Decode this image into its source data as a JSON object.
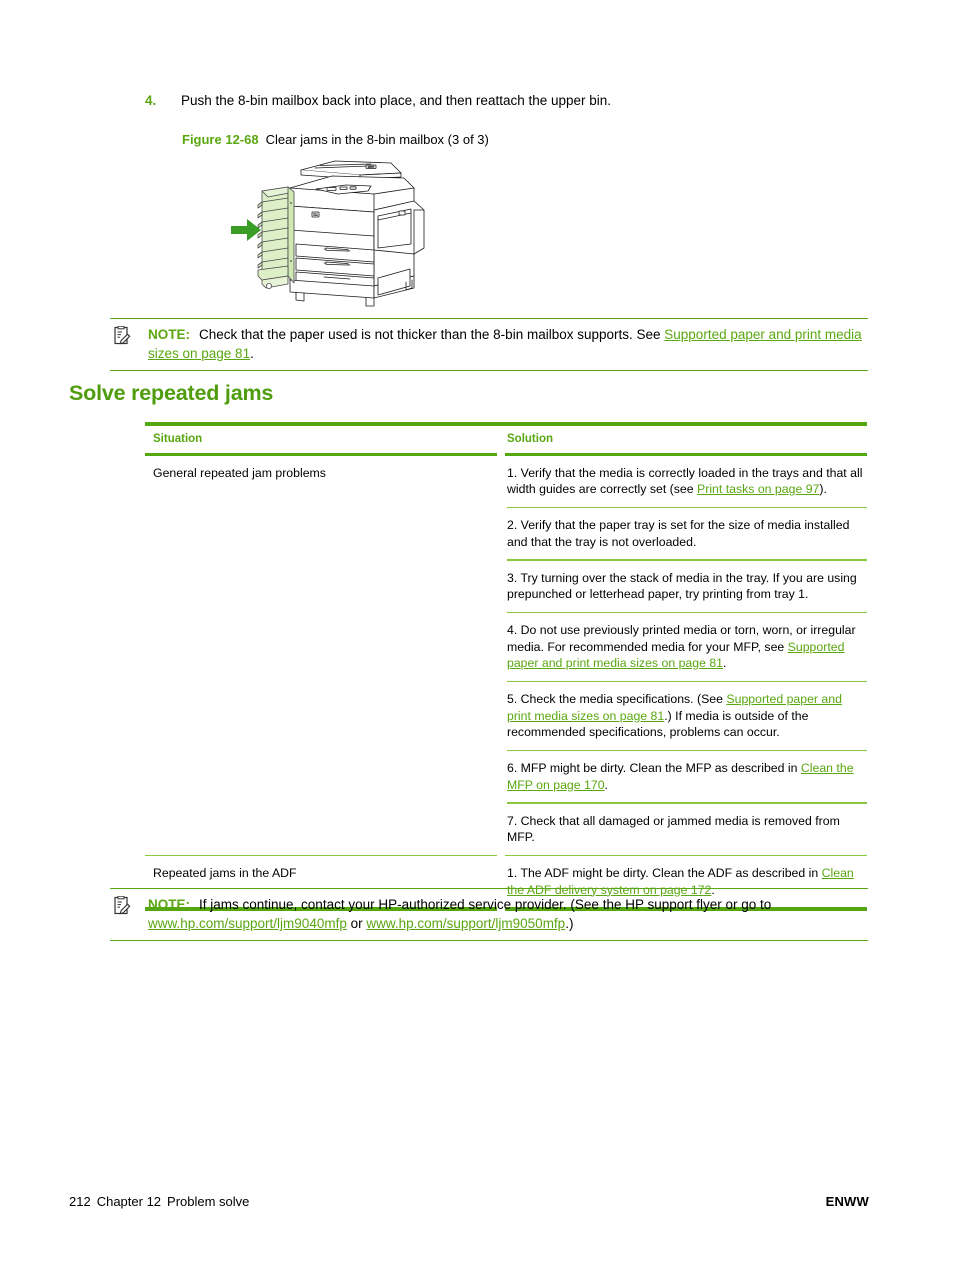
{
  "step": {
    "number": "4.",
    "text": "Push the 8-bin mailbox back into place, and then reattach the upper bin."
  },
  "figure": {
    "label": "Figure 12-68",
    "title": "Clear jams in the 8-bin mailbox (3 of 3)",
    "alt": "Line drawing of an HP LaserJet MFP with the 8-bin mailbox highlighted in green on the left side and a green arrow pointing toward it",
    "accent_color": "#6cbf3f",
    "arrow_color": "#3a9d26"
  },
  "note_top": {
    "keyword": "NOTE:",
    "text_before": "Check that the paper used is not thicker than the 8-bin mailbox supports. See ",
    "link": "Supported paper and print media sizes on page 81",
    "text_after": "."
  },
  "heading": "Solve repeated jams",
  "table": {
    "headers": {
      "situation": "Situation",
      "solution": "Solution"
    },
    "rows": [
      {
        "situation": "General repeated jam problems",
        "solutions": [
          {
            "parts": [
              {
                "type": "text",
                "value": "1. Verify that the media is correctly loaded in the trays and that all width guides are correctly set (see "
              },
              {
                "type": "link",
                "value": "Print tasks on page 97"
              },
              {
                "type": "text",
                "value": ")."
              }
            ]
          },
          {
            "parts": [
              {
                "type": "text",
                "value": "2. Verify that the paper tray is set for the size of media installed and that the tray is not overloaded."
              }
            ]
          },
          {
            "parts": [
              {
                "type": "text",
                "value": "3. Try turning over the stack of media in the tray. If you are using prepunched or letterhead paper, try printing from tray 1."
              }
            ]
          },
          {
            "parts": [
              {
                "type": "text",
                "value": "4. Do not use previously printed media or torn, worn, or irregular media. For recommended media for your MFP, see "
              },
              {
                "type": "link",
                "value": "Supported paper and print media sizes on page 81"
              },
              {
                "type": "text",
                "value": "."
              }
            ]
          },
          {
            "parts": [
              {
                "type": "text",
                "value": "5. Check the media specifications. (See "
              },
              {
                "type": "link",
                "value": "Supported paper and print media sizes on page 81"
              },
              {
                "type": "text",
                "value": ".) If media is outside of the recommended specifications, problems can occur."
              }
            ]
          },
          {
            "parts": [
              {
                "type": "text",
                "value": "6. MFP might be dirty. Clean the MFP as described in "
              },
              {
                "type": "link",
                "value": "Clean the MFP on page 170"
              },
              {
                "type": "text",
                "value": "."
              }
            ]
          },
          {
            "parts": [
              {
                "type": "text",
                "value": "7. Check that all damaged or jammed media is removed from MFP."
              }
            ]
          }
        ]
      },
      {
        "situation": "Repeated jams in the ADF",
        "solutions": [
          {
            "parts": [
              {
                "type": "text",
                "value": "1. The ADF might be dirty. Clean the ADF as described in "
              },
              {
                "type": "link",
                "value": "Clean the ADF delivery system on page 172"
              },
              {
                "type": "text",
                "value": "."
              }
            ]
          }
        ]
      }
    ]
  },
  "note_bottom": {
    "keyword": "NOTE:",
    "text_before": "If jams continue, contact your HP-authorized service provider. (See the HP support flyer or go to ",
    "link1": "www.hp.com/support/ljm9040mfp",
    "between": " or ",
    "link2": "www.hp.com/support/ljm9050mfp",
    "text_after": ".)"
  },
  "footer": {
    "page_number": "212",
    "chapter": "Chapter 12",
    "chapter_title": "Problem solve",
    "right": "ENWW"
  },
  "colors": {
    "accent_green": "#5aa711",
    "rule_green": "#55a70f",
    "thin_rule_green": "#8bc63f",
    "heading_green": "#4f9c0d"
  }
}
